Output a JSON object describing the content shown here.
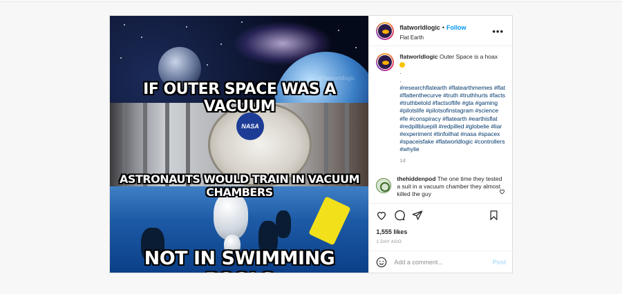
{
  "meme": {
    "caption_top": "IF OUTER SPACE WAS A VACUUM",
    "caption_middle": "ASTRONAUTS WOULD TRAIN IN VACUUM CHAMBERS",
    "caption_bottom": "NOT IN SWIMMING POOLS",
    "nasa_logo": "NASA",
    "watermark": "@flatworldlogic"
  },
  "header": {
    "username": "flatworldlogic",
    "separator": "•",
    "follow_label": "Follow",
    "location": "Flat Earth",
    "more_icon": "more-horizontal-icon"
  },
  "caption_comment": {
    "username": "flatworldlogic",
    "text": "Outer Space is a hoax",
    "emoji": "smiling-face-icon",
    "dot1": ".",
    "dot2": ".",
    "hashtags": "#researchflatearth #flatearthmemes #flat #flattenthecurve #truth #truthhurts #facts #truthbetold #factsoflife #gta #gaming #pilotslife #pilotsofinstagram #science #fe #conspiracy #flatearth #earthisflat #redpillbluepill #redpilled #globelie #liar #experiment #tinfoilhat #nasa #spacex #spaceisfake #flatworldlogic #controllers #whylie",
    "time": "1d"
  },
  "comment": {
    "username": "thehiddenpod",
    "text": "The one time they tested a suit in a vacuum chamber they almost killed the guy"
  },
  "actions": {
    "likes": "1,555 likes",
    "ago": "1 DAY AGO"
  },
  "add_comment": {
    "placeholder": "Add a comment...",
    "post_label": "Post"
  },
  "colors": {
    "link": "#0095f6",
    "hashtag": "#00376b",
    "muted": "#8e8e8e"
  }
}
